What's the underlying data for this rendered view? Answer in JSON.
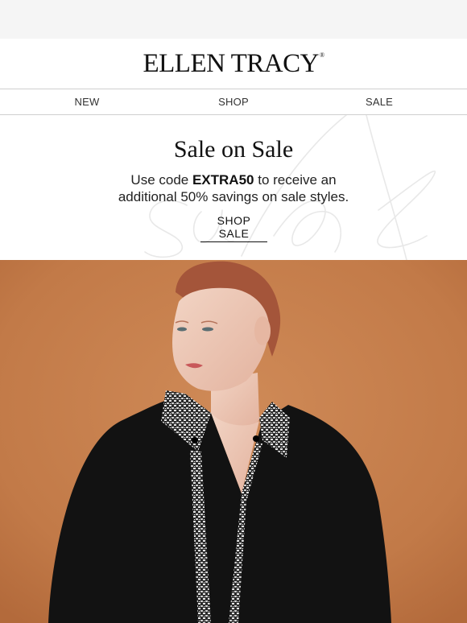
{
  "brand": {
    "name": "ELLEN TRACY",
    "trademark": "®"
  },
  "nav": {
    "items": [
      "NEW",
      "SHOP",
      "SALE"
    ]
  },
  "promo": {
    "title": "Sale on Sale",
    "line1_prefix": "Use code ",
    "code": "EXTRA50",
    "line1_suffix": " to receive an",
    "line2": "additional 50% savings on sale styles.",
    "cta": "SHOP SALE",
    "background_script": "sale"
  },
  "hero": {
    "background_color": "#c27a48",
    "subject": "model in black blouse with tweed trim"
  },
  "colors": {
    "accent": "#111111",
    "top_strip": "#f5f5f5",
    "divider": "#cfcfcf"
  }
}
